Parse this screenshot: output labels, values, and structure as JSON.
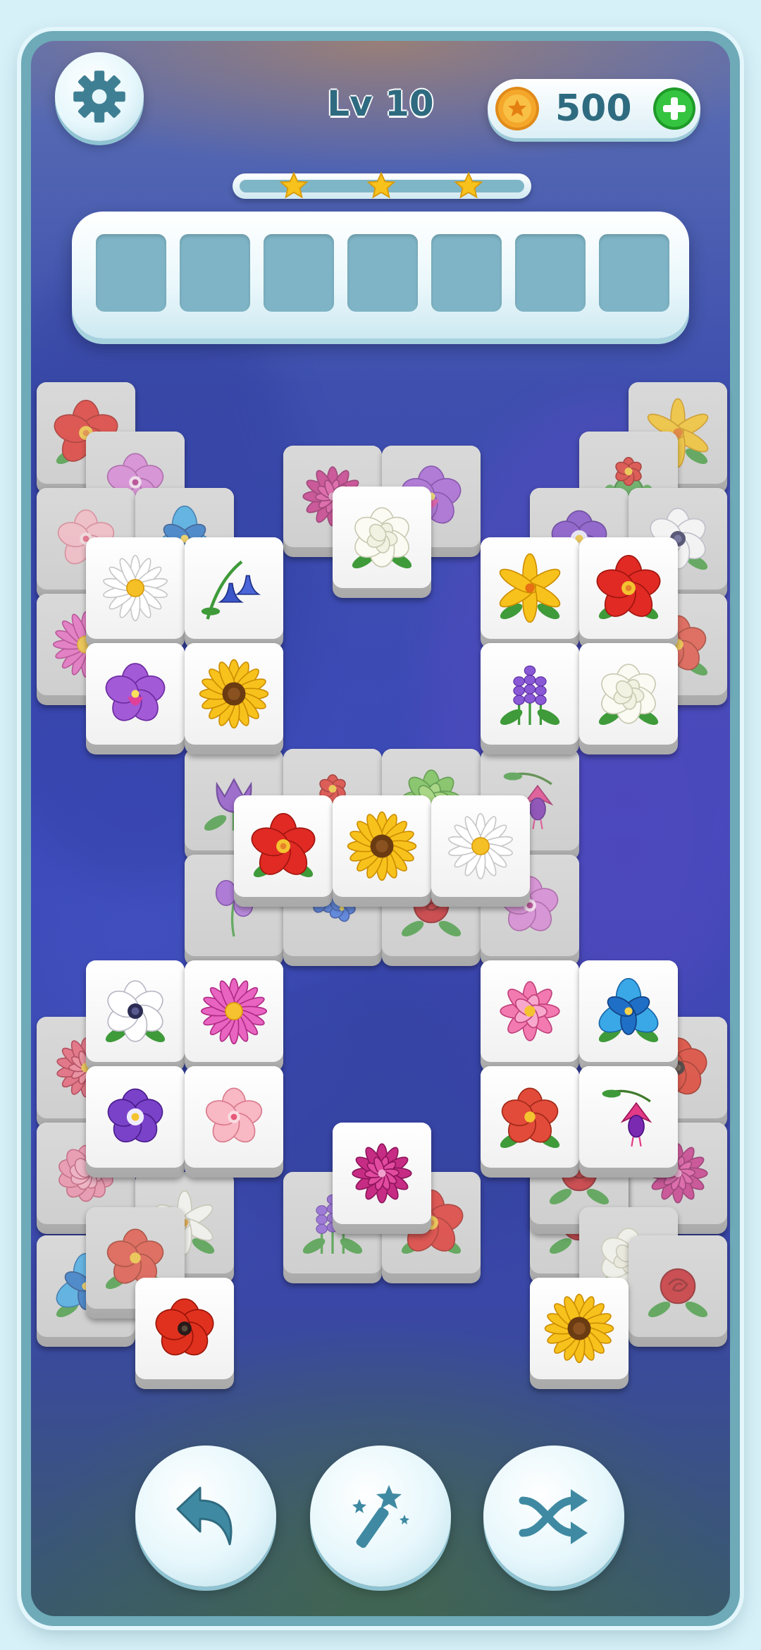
{
  "hud": {
    "level_label": "Lv 10",
    "coins": "500",
    "stars_earned": 3,
    "progress_fraction": 0.0
  },
  "slots": {
    "count": 7
  },
  "icons": {
    "settings": "gear-icon",
    "coin": "coin-icon",
    "add": "plus-icon",
    "undo": "undo-arrow-icon",
    "magic": "magic-wand-icon",
    "shuffle": "shuffle-icon"
  },
  "colors": {
    "accent": "#2f6b80",
    "slot": "#7eb4c5",
    "star": "#f7c21c",
    "add_button": "#2fbf3b"
  },
  "tiles": [
    {
      "flower": "red-hibiscus",
      "covered": true
    },
    {
      "flower": "yellow-lily",
      "covered": true
    },
    {
      "flower": "pink-orchid",
      "covered": true
    },
    {
      "flower": "cactus-flower",
      "covered": true
    },
    {
      "flower": "pink-cherry-blossom",
      "covered": true
    },
    {
      "flower": "blue-iris",
      "covered": true
    },
    {
      "flower": "purple-pansy",
      "covered": true
    },
    {
      "flower": "white-anemone",
      "covered": true
    },
    {
      "flower": "magenta-dahlia",
      "covered": true
    },
    {
      "flower": "purple-orchid",
      "covered": true
    },
    {
      "flower": "white-gardenia",
      "covered": false
    },
    {
      "flower": "pink-gerbera",
      "covered": true
    },
    {
      "flower": "red-begonia",
      "covered": true
    },
    {
      "flower": "white-daisy",
      "covered": false
    },
    {
      "flower": "bluebell",
      "covered": false
    },
    {
      "flower": "yellow-lily",
      "covered": false
    },
    {
      "flower": "red-hibiscus",
      "covered": false
    },
    {
      "flower": "purple-orchid",
      "covered": false
    },
    {
      "flower": "sunflower",
      "covered": false
    },
    {
      "flower": "lavender",
      "covered": false
    },
    {
      "flower": "white-gardenia",
      "covered": false
    },
    {
      "flower": "purple-tulip",
      "covered": true
    },
    {
      "flower": "cactus-flower",
      "covered": true
    },
    {
      "flower": "green-succulent",
      "covered": true
    },
    {
      "flower": "fuchsia",
      "covered": true
    },
    {
      "flower": "sweet-pea",
      "covered": true
    },
    {
      "flower": "blue-forget-me-not",
      "covered": true
    },
    {
      "flower": "red-rose",
      "covered": true
    },
    {
      "flower": "pink-orchid",
      "covered": true
    },
    {
      "flower": "red-hibiscus",
      "covered": false
    },
    {
      "flower": "sunflower",
      "covered": false
    },
    {
      "flower": "white-daisy",
      "covered": false
    },
    {
      "flower": "pink-zinnia",
      "covered": true
    },
    {
      "flower": "red-poppy",
      "covered": true
    },
    {
      "flower": "white-anemone",
      "covered": false
    },
    {
      "flower": "pink-gerbera",
      "covered": false
    },
    {
      "flower": "pink-lotus",
      "covered": false
    },
    {
      "flower": "blue-iris",
      "covered": false
    },
    {
      "flower": "pink-peony",
      "covered": true
    },
    {
      "flower": "magenta-dahlia",
      "covered": true
    },
    {
      "flower": "purple-pansy",
      "covered": false
    },
    {
      "flower": "pink-cherry-blossom",
      "covered": false
    },
    {
      "flower": "red-begonia",
      "covered": false
    },
    {
      "flower": "fuchsia",
      "covered": false
    },
    {
      "flower": "white-lily",
      "covered": true
    },
    {
      "flower": "red-rose",
      "covered": true
    },
    {
      "flower": "lavender",
      "covered": true
    },
    {
      "flower": "red-hibiscus",
      "covered": true
    },
    {
      "flower": "red-rose",
      "covered": true
    },
    {
      "flower": "magenta-dahlia",
      "covered": false
    },
    {
      "flower": "blue-iris",
      "covered": true
    },
    {
      "flower": "red-begonia",
      "covered": true
    },
    {
      "flower": "white-gardenia",
      "covered": true
    },
    {
      "flower": "red-rose",
      "covered": true
    },
    {
      "flower": "red-poppy",
      "covered": false
    },
    {
      "flower": "sunflower",
      "covered": false
    }
  ]
}
